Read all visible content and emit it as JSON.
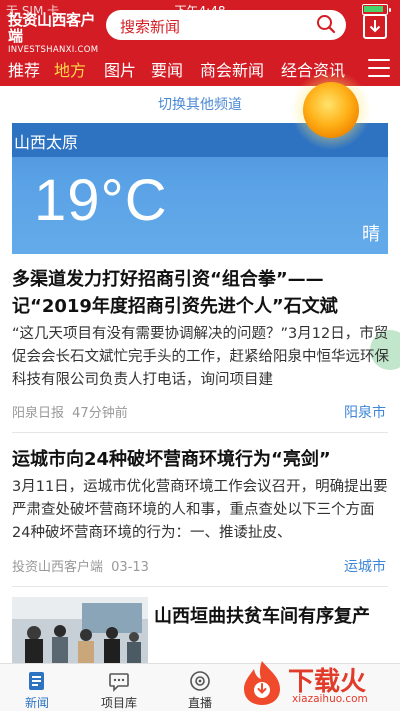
{
  "status_bar": {
    "carrier": "无 SIM 卡",
    "time": "下午4:48",
    "battery_percent": 90
  },
  "header": {
    "logo_cn": "投资山西客户端",
    "logo_en": "INVESTSHANXI.COM",
    "search_placeholder": "搜索新闻",
    "icons": [
      "search-icon",
      "download-icon",
      "menu-icon"
    ],
    "brand_color": "#d31c24",
    "active_tab_color": "#ffd84a"
  },
  "nav": {
    "tabs": [
      {
        "label": "推荐",
        "active": false
      },
      {
        "label": "地方",
        "active": true
      },
      {
        "label": "图片",
        "active": false
      },
      {
        "label": "要闻",
        "active": false
      },
      {
        "label": "商会新闻",
        "active": false
      },
      {
        "label": "经合资讯",
        "active": false
      }
    ]
  },
  "switch_channel": {
    "label": "切换其他频道"
  },
  "weather": {
    "city": "山西太原",
    "temperature": "19°C",
    "condition": "晴",
    "icon": "sun-icon"
  },
  "articles": [
    {
      "title": "多渠道发力打好招商引资“组合拳”——记“2019年度招商引资先进个人”石文斌",
      "summary": "“这几天项目有没有需要协调解决的问题？”3月12日，市贸促会会长石文斌忙完手头的工作，赶紧给阳泉中恒华远环保科技有限公司负责人打电话，询问项目建",
      "source": "阳泉日报",
      "time": "47分钟前",
      "tag": "阳泉市"
    },
    {
      "title": "运城市向24种破坏营商环境行为“亮剑”",
      "summary": "3月11日，运城市优化营商环境工作会议召开，明确提出要严肃查处破坏营商环境的人和事，重点查处以下三个方面24种破坏营商环境的行为：一、推诿扯皮、",
      "source": "投资山西客户端",
      "time": "03-13",
      "tag": "运城市"
    },
    {
      "title": "山西垣曲扶贫车间有序复产",
      "thumbnail": "photo-thumbnail"
    }
  ],
  "tabbar": {
    "tabs": [
      {
        "label": "新闻",
        "icon": "news-icon",
        "active": true
      },
      {
        "label": "项目库",
        "icon": "chat-bubble-icon",
        "active": false
      },
      {
        "label": "直播",
        "icon": "live-icon",
        "active": false
      }
    ]
  },
  "watermark": {
    "text": "下载火",
    "url": "xiazaihuo.com"
  }
}
